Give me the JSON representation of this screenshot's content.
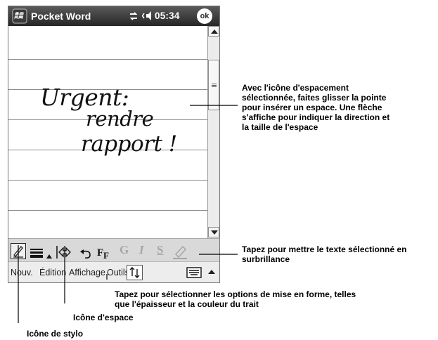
{
  "titlebar": {
    "app_title": "Pocket Word",
    "clock": "05:34",
    "ok_label": "ok",
    "icons": [
      "windows-start-icon",
      "connectivity-icon",
      "speaker-icon"
    ]
  },
  "document": {
    "handwriting": [
      "Urgent:",
      "rendre",
      "rapport !"
    ]
  },
  "menubar": {
    "items": [
      "Nouv.",
      "Édition",
      "Affichage",
      "Outils"
    ]
  },
  "toolbar": {
    "tools": [
      "pen-icon",
      "formatting-lines-icon",
      "up-arrow-icon",
      "space-icon",
      "undo-icon",
      "font-format-icon",
      "bold-icon",
      "italic-icon",
      "underline-icon",
      "highlight-icon"
    ],
    "letters": {
      "bold": "G",
      "italic": "I",
      "underline": "S"
    }
  },
  "callouts": {
    "space_arrow": [
      "Avec l'icône d'espacement",
      "sélectionnée, faites glisser la pointe",
      "pour insérer un espace. Une flèche",
      "s'affiche pour indiquer la direction et",
      "la taille de l'espace"
    ],
    "highlight": [
      "Tapez pour mettre le texte sélectionné en",
      "surbrillance"
    ],
    "formatting": [
      "Tapez pour sélectionner les options de mise en forme, telles",
      "que l'épaisseur et la couleur du trait"
    ],
    "space_icon": "Icône d'espace",
    "pen_icon": "Icône de stylo"
  }
}
